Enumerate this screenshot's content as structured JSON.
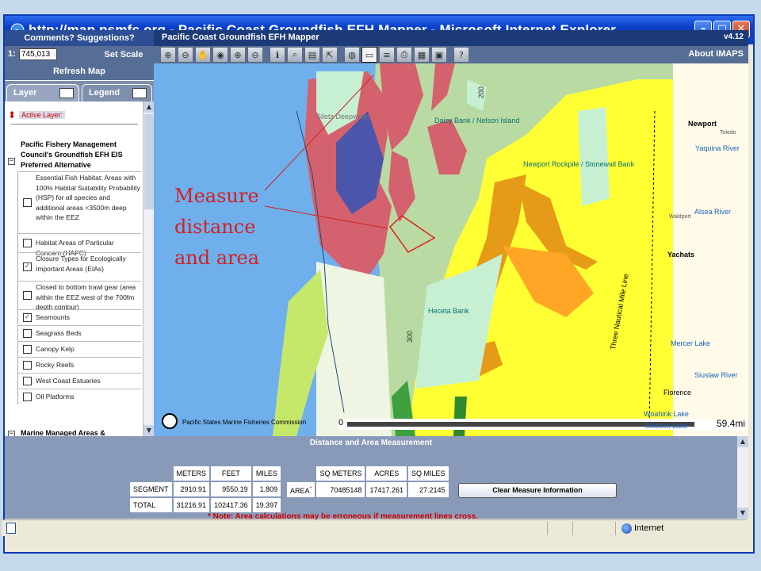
{
  "window": {
    "title": "http://map.psmfc.org - Pacific Coast Groundfish EFH Mapper - Microsoft Internet Explorer",
    "minimize_icon": "minimize-icon",
    "maximize_icon": "maximize-icon",
    "close_icon": "close-icon"
  },
  "appbar": {
    "comments_label": "Comments? Suggestions?",
    "app_title": "Pacific Coast Groundfish EFH Mapper",
    "version": "v4.12"
  },
  "toolrow": {
    "scale_prefix": "1:",
    "scale_value": "745,013",
    "set_scale_label": "Set Scale",
    "about_label": "About IMAPS",
    "tools": [
      {
        "name": "zoom-in-icon",
        "glyph": "⊕"
      },
      {
        "name": "zoom-out-icon",
        "glyph": "⊖"
      },
      {
        "name": "pan-hand-icon",
        "glyph": "✋"
      },
      {
        "name": "full-extent-icon",
        "glyph": "◉"
      },
      {
        "name": "zoom-active-icon",
        "glyph": "⊕"
      },
      {
        "name": "zoom-last-icon",
        "glyph": "⊖"
      },
      {
        "name": "identify-icon",
        "glyph": "ℹ"
      },
      {
        "name": "find-icon",
        "glyph": "⌕"
      },
      {
        "name": "query-icon",
        "glyph": "▤"
      },
      {
        "name": "select-icon",
        "glyph": "⇱"
      },
      {
        "name": "globe-icon",
        "glyph": "◍"
      },
      {
        "name": "measure-icon",
        "glyph": "▭"
      },
      {
        "name": "buffer-icon",
        "glyph": "≡"
      },
      {
        "name": "print-icon",
        "glyph": "⎙"
      },
      {
        "name": "layers-icon",
        "glyph": "▦"
      },
      {
        "name": "settings-icon",
        "glyph": "▣"
      },
      {
        "name": "help-icon",
        "glyph": "?"
      }
    ]
  },
  "left": {
    "refresh_label": "Refresh Map",
    "tab_layer": "Layer",
    "tab_legend": "Legend",
    "active_layer_label": "Active Layer:",
    "group1_title": "Pacific Fishery Management Council's Groundfish EFH EIS Preferred Alternative",
    "group2_title": "Marine Managed Areas &",
    "layers": [
      {
        "label": "Essential Fish Habitat: Areas with 100% Habitat Suitability Probability (HSP) for all species and additional areas <3500m deep within the EEZ",
        "checked": false
      },
      {
        "label": "Habitat Areas of Particular Concern (HAPC)",
        "checked": false
      },
      {
        "label": "Closure Types for Ecologically Important Areas (EIAs)",
        "checked": true
      },
      {
        "label": "Closed to bottom trawl gear (area within the EEZ west of the 700fm depth contour)",
        "checked": false
      },
      {
        "label": "Seamounts",
        "checked": true
      },
      {
        "label": "Seagrass Beds",
        "checked": false
      },
      {
        "label": "Canopy Kelp",
        "checked": false
      },
      {
        "label": "Rocky Reefs",
        "checked": false
      },
      {
        "label": "West Coast Estuaries",
        "checked": false
      },
      {
        "label": "Oil Platforms",
        "checked": false
      }
    ]
  },
  "map": {
    "annotation": [
      "Measure",
      "distance",
      "and area"
    ],
    "credit": "Pacific States Marine Fisheries Commission",
    "scale_zero": "0",
    "scale_value": "59.4mi",
    "labels": {
      "siletz": "Siletz Deepwater",
      "daisy": "Daisy Bank / Nelson Island",
      "newport_rockpile": "Newport Rockpile / Stonewall Bank",
      "heceta": "Heceta Bank",
      "newport": "Newport",
      "yaquina": "Yaquina River",
      "toledo": "Toledo",
      "alsea": "Alsea River",
      "waldport": "Waldport",
      "yachats": "Yachats",
      "mercer": "Mercer Lake",
      "siuslaw": "Siuslaw River",
      "florence": "Florence",
      "woahink": "Woahink Lake",
      "siltcoos": "Siltcoos Lake",
      "three_nm": "Three Nautical Mile Line",
      "depth_200": "200",
      "depth_300": "300"
    }
  },
  "measure": {
    "title": "Distance and Area Measurement",
    "headers1": [
      "METERS",
      "FEET",
      "MILES"
    ],
    "rows1": [
      {
        "label": "SEGMENT",
        "values": [
          "2910.91",
          "9550.19",
          "1.809"
        ]
      },
      {
        "label": "TOTAL",
        "values": [
          "31216.91",
          "102417.36",
          "19.397"
        ]
      }
    ],
    "headers2": [
      "SQ METERS",
      "ACRES",
      "SQ MILES"
    ],
    "area_label": "AREA",
    "area_mark": "*",
    "area_values": [
      "70485148",
      "17417.261",
      "27.2145"
    ],
    "clear_label": "Clear Measure Information",
    "note": "* Note: Area calculations may be erroneous if measurement lines cross."
  },
  "status": {
    "zone": "Internet"
  },
  "colors": {
    "titlebar": "#0a3fc8",
    "ocean": "#6fb0ec",
    "efh_yellow": "#ffff33",
    "hapc_red": "#d4626e",
    "closure_green": "#b8dba0",
    "orange": "#e59a18",
    "annotation_red": "#d42020"
  }
}
